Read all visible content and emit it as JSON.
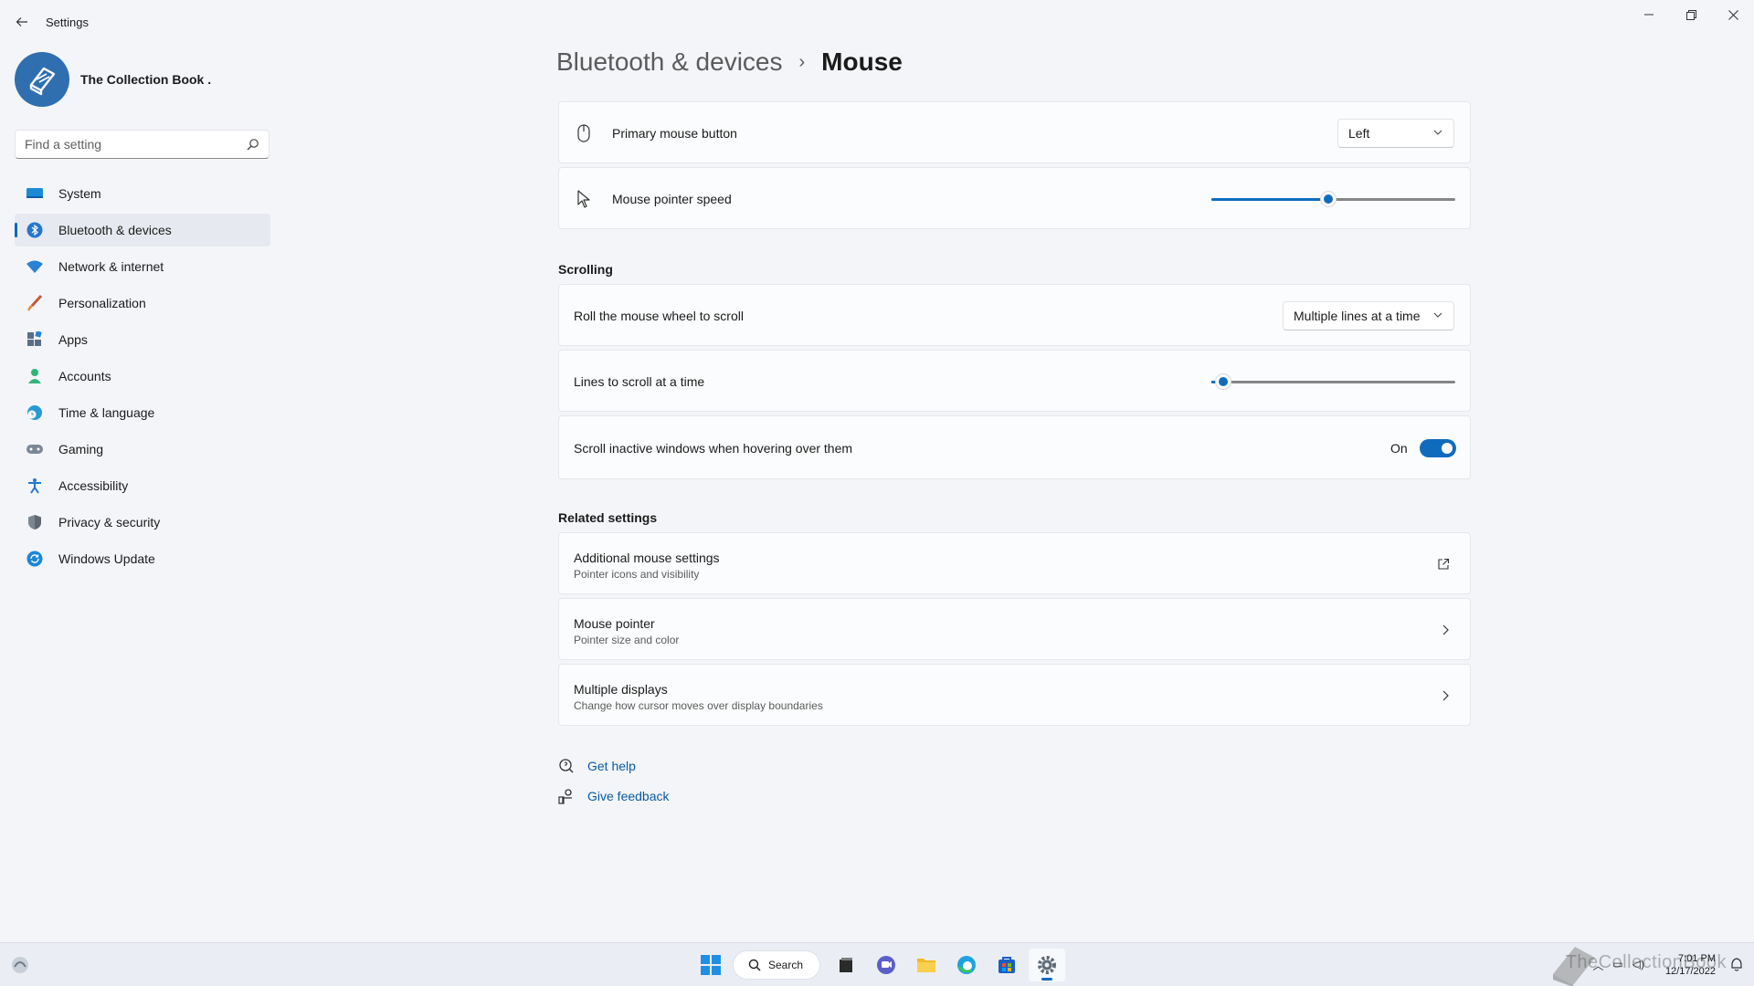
{
  "window": {
    "title": "Settings"
  },
  "profile": {
    "name": "The Collection Book ."
  },
  "search": {
    "placeholder": "Find a setting"
  },
  "sidebar": {
    "items": [
      {
        "label": "System",
        "icon": "monitor-icon"
      },
      {
        "label": "Bluetooth & devices",
        "icon": "bluetooth-icon",
        "active": true
      },
      {
        "label": "Network & internet",
        "icon": "wifi-icon"
      },
      {
        "label": "Personalization",
        "icon": "brush-icon"
      },
      {
        "label": "Apps",
        "icon": "apps-icon"
      },
      {
        "label": "Accounts",
        "icon": "person-icon"
      },
      {
        "label": "Time & language",
        "icon": "globe-clock-icon"
      },
      {
        "label": "Gaming",
        "icon": "gamepad-icon"
      },
      {
        "label": "Accessibility",
        "icon": "accessibility-icon"
      },
      {
        "label": "Privacy & security",
        "icon": "shield-icon"
      },
      {
        "label": "Windows Update",
        "icon": "update-icon"
      }
    ]
  },
  "breadcrumb": {
    "parent": "Bluetooth & devices",
    "separator": "›",
    "current": "Mouse"
  },
  "settings": {
    "primary_button": {
      "label": "Primary mouse button",
      "value": "Left"
    },
    "pointer_speed": {
      "label": "Mouse pointer speed",
      "value_fraction": 0.48
    },
    "scrolling_title": "Scrolling",
    "roll_wheel": {
      "label": "Roll the mouse wheel to scroll",
      "value": "Multiple lines at a time"
    },
    "lines_to_scroll": {
      "label": "Lines to scroll at a time",
      "value_fraction": 0.05
    },
    "scroll_inactive": {
      "label": "Scroll inactive windows when hovering over them",
      "state": "On"
    },
    "related_title": "Related settings",
    "related": [
      {
        "title": "Additional mouse settings",
        "subtitle": "Pointer icons and visibility",
        "icon": "external-link-icon"
      },
      {
        "title": "Mouse pointer",
        "subtitle": "Pointer size and color",
        "icon": "chevron-right-icon"
      },
      {
        "title": "Multiple displays",
        "subtitle": "Change how cursor moves over display boundaries",
        "icon": "chevron-right-icon"
      }
    ]
  },
  "help": {
    "get_help": "Get help",
    "give_feedback": "Give feedback"
  },
  "taskbar": {
    "search_label": "Search",
    "time": "7:01 PM",
    "date": "12/17/2022",
    "watermark": "TheCollectionBook"
  },
  "colors": {
    "accent": "#0f6cbd",
    "background": "#f3f5f9",
    "card": "#fbfcfd"
  }
}
